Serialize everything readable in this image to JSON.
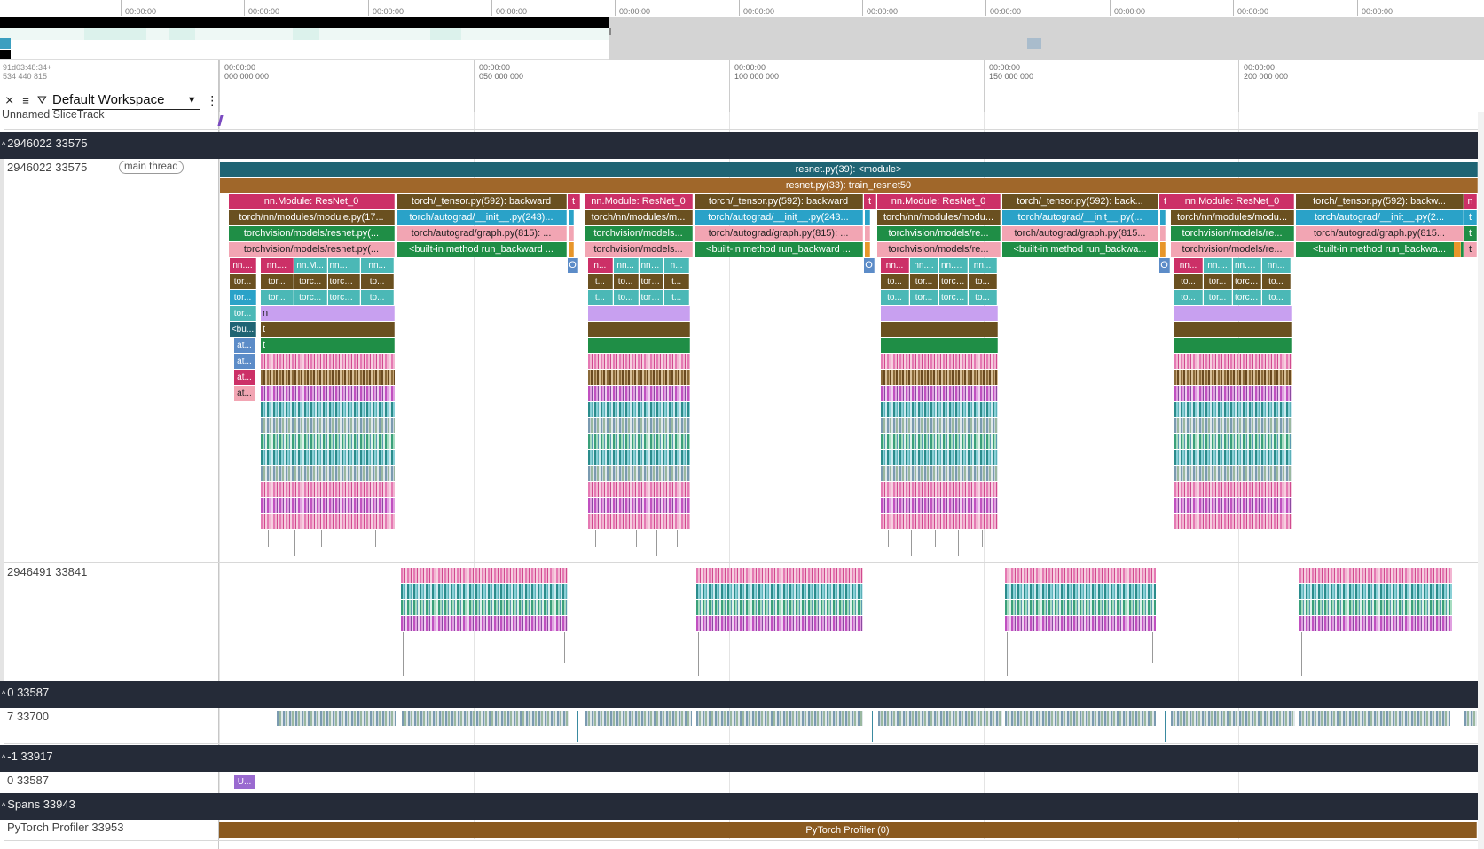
{
  "overview": {
    "tick_labels": [
      "00:00:00",
      "00:00:00",
      "00:00:00",
      "00:00:00",
      "00:00:00",
      "00:00:00",
      "00:00:00",
      "00:00:00",
      "00:00:00",
      "00:00:00",
      "00:00:00",
      "00:00:00"
    ]
  },
  "time_origin": {
    "line1": "91d03:48:34+",
    "line2": "534 440 815"
  },
  "axis": {
    "ticks": [
      {
        "l1": "00:00:00",
        "l2": "000 000 000"
      },
      {
        "l1": "00:00:00",
        "l2": "050 000 000"
      },
      {
        "l1": "00:00:00",
        "l2": "100 000 000"
      },
      {
        "l1": "00:00:00",
        "l2": "150 000 000"
      },
      {
        "l1": "00:00:00",
        "l2": "200 000 000"
      }
    ]
  },
  "toolbar": {
    "workspace": "Default Workspace"
  },
  "tracks": {
    "unnamed": "Unnamed SliceTrack",
    "group1": "2946022 33575",
    "thread_main": "2946022 33575",
    "main_thread_pill": "main thread",
    "thread2": "2946491 33841",
    "group2": "0 33587",
    "thread3": "7 33700",
    "group3": "-1 33917",
    "thread4": "0 33587",
    "thread4_slice": "U...",
    "group4": "Spans 33943",
    "thread5": "PyTorch Profiler 33953",
    "profiler_slice": "PyTorch Profiler (0)"
  },
  "slices": {
    "module": "resnet.py(39): <module>",
    "train": "resnet.py(33): train_resnet50",
    "iterations": [
      {
        "forward": "nn.Module: ResNet_0",
        "fwd2": "torch/nn/modules/module.py(17...",
        "fwd3": "torchvision/models/resnet.py(...",
        "fwd4": "torchvision/models/resnet.py(...",
        "backward": "torch/_tensor.py(592): backward",
        "bwd2": "torch/autograd/__init__.py(243)...",
        "bwd3": "torch/autograd/graph.py(815): ...",
        "bwd4": "<built-in method run_backward ..."
      },
      {
        "forward": "nn.Module: ResNet_0",
        "fwd2": "torch/nn/modules/m...",
        "fwd3": "torchvision/models...",
        "fwd4": "torchvision/models...",
        "backward": "torch/_tensor.py(592): backward",
        "bwd2": "torch/autograd/__init__.py(243...",
        "bwd3": "torch/autograd/graph.py(815): ...",
        "bwd4": "<built-in method run_backward ..."
      },
      {
        "forward": "nn.Module: ResNet_0",
        "fwd2": "torch/nn/modules/modu...",
        "fwd3": "torchvision/models/re...",
        "fwd4": "torchvision/models/re...",
        "backward": "torch/_tensor.py(592): back...",
        "bwd2": "torch/autograd/__init__.py(...",
        "bwd3": "torch/autograd/graph.py(815...",
        "bwd4": "<built-in method run_backwa..."
      },
      {
        "forward": "nn.Module: ResNet_0",
        "fwd2": "torch/nn/modules/modu...",
        "fwd3": "torchvision/models/re...",
        "fwd4": "torchvision/models/re...",
        "backward": "torch/_tensor.py(592): backw...",
        "bwd2": "torch/autograd/__init__.py(2...",
        "bwd3": "torch/autograd/graph.py(815...",
        "bwd4": "<built-in method run_backwa..."
      }
    ],
    "small": {
      "t": "t",
      "o": "O",
      "n": "n",
      "first_col": [
        "nn....",
        "tor...",
        "tor...",
        "tor...",
        "<bu...",
        "at...",
        "at...",
        "at...",
        "at..."
      ],
      "iter0_row5": [
        "nn....",
        "nn.M...",
        "nn.Modu...",
        "nn..."
      ],
      "iter0_row6": [
        "tor...",
        "torc...",
        "torch/n...",
        "to..."
      ],
      "iter0_row7": [
        "tor...",
        "torc...",
        "torch/n...",
        "to..."
      ],
      "iter1_row5": [
        "n...",
        "nn...",
        "nn.Mo...",
        "n..."
      ],
      "iter1_row6": [
        "t...",
        "to...",
        "torch...",
        "t..."
      ],
      "iter1_row7": [
        "t...",
        "to...",
        "torch...",
        "t..."
      ],
      "iter2_row5": [
        "nn...",
        "nn....",
        "nn.Mod...",
        "nn..."
      ],
      "iter2_row6": [
        "to...",
        "tor...",
        "torch/...",
        "to..."
      ],
      "iter2_row7": [
        "to...",
        "tor...",
        "torch/...",
        "to..."
      ],
      "iter3_row5": [
        "nn...",
        "nn....",
        "nn.Mod...",
        "nn..."
      ],
      "iter3_row6": [
        "to...",
        "tor...",
        "torch/...",
        "to..."
      ],
      "iter3_row7": [
        "to...",
        "tor...",
        "torch/...",
        "to..."
      ],
      "iter0_n": "n",
      "iter0_t1": "t",
      "iter0_t2": "t"
    }
  }
}
